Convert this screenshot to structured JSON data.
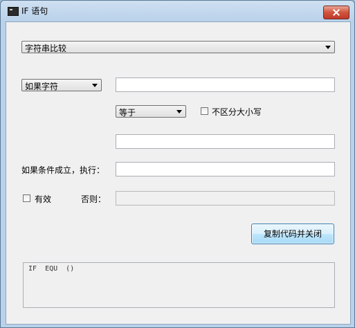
{
  "window": {
    "title": "IF 语句"
  },
  "form": {
    "compare_type_select": "字符串比较",
    "condition_select": "如果字符",
    "operator_select": "等于",
    "case_insensitive_label": "不区分大小写",
    "then_label": "如果条件成立，执行：",
    "valid_label": "有效",
    "else_label": "否则：",
    "copy_close_button": "复制代码并关闭",
    "code_preview": "IF  EQU  ()"
  }
}
